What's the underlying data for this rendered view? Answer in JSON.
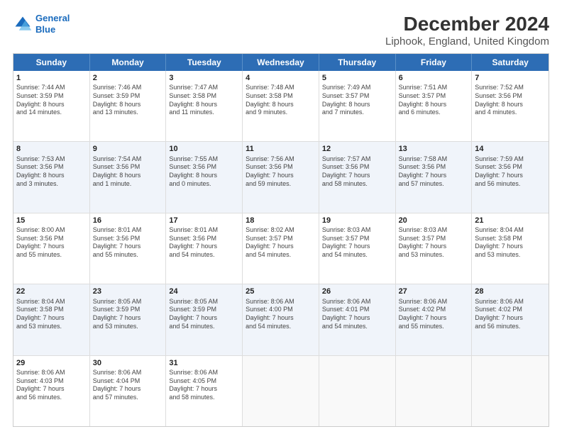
{
  "header": {
    "logo_line1": "General",
    "logo_line2": "Blue",
    "title": "December 2024",
    "subtitle": "Liphook, England, United Kingdom"
  },
  "days_of_week": [
    "Sunday",
    "Monday",
    "Tuesday",
    "Wednesday",
    "Thursday",
    "Friday",
    "Saturday"
  ],
  "rows": [
    [
      {
        "day": "1",
        "lines": [
          "Sunrise: 7:44 AM",
          "Sunset: 3:59 PM",
          "Daylight: 8 hours",
          "and 14 minutes."
        ]
      },
      {
        "day": "2",
        "lines": [
          "Sunrise: 7:46 AM",
          "Sunset: 3:59 PM",
          "Daylight: 8 hours",
          "and 13 minutes."
        ]
      },
      {
        "day": "3",
        "lines": [
          "Sunrise: 7:47 AM",
          "Sunset: 3:58 PM",
          "Daylight: 8 hours",
          "and 11 minutes."
        ]
      },
      {
        "day": "4",
        "lines": [
          "Sunrise: 7:48 AM",
          "Sunset: 3:58 PM",
          "Daylight: 8 hours",
          "and 9 minutes."
        ]
      },
      {
        "day": "5",
        "lines": [
          "Sunrise: 7:49 AM",
          "Sunset: 3:57 PM",
          "Daylight: 8 hours",
          "and 7 minutes."
        ]
      },
      {
        "day": "6",
        "lines": [
          "Sunrise: 7:51 AM",
          "Sunset: 3:57 PM",
          "Daylight: 8 hours",
          "and 6 minutes."
        ]
      },
      {
        "day": "7",
        "lines": [
          "Sunrise: 7:52 AM",
          "Sunset: 3:56 PM",
          "Daylight: 8 hours",
          "and 4 minutes."
        ]
      }
    ],
    [
      {
        "day": "8",
        "lines": [
          "Sunrise: 7:53 AM",
          "Sunset: 3:56 PM",
          "Daylight: 8 hours",
          "and 3 minutes."
        ]
      },
      {
        "day": "9",
        "lines": [
          "Sunrise: 7:54 AM",
          "Sunset: 3:56 PM",
          "Daylight: 8 hours",
          "and 1 minute."
        ]
      },
      {
        "day": "10",
        "lines": [
          "Sunrise: 7:55 AM",
          "Sunset: 3:56 PM",
          "Daylight: 8 hours",
          "and 0 minutes."
        ]
      },
      {
        "day": "11",
        "lines": [
          "Sunrise: 7:56 AM",
          "Sunset: 3:56 PM",
          "Daylight: 7 hours",
          "and 59 minutes."
        ]
      },
      {
        "day": "12",
        "lines": [
          "Sunrise: 7:57 AM",
          "Sunset: 3:56 PM",
          "Daylight: 7 hours",
          "and 58 minutes."
        ]
      },
      {
        "day": "13",
        "lines": [
          "Sunrise: 7:58 AM",
          "Sunset: 3:56 PM",
          "Daylight: 7 hours",
          "and 57 minutes."
        ]
      },
      {
        "day": "14",
        "lines": [
          "Sunrise: 7:59 AM",
          "Sunset: 3:56 PM",
          "Daylight: 7 hours",
          "and 56 minutes."
        ]
      }
    ],
    [
      {
        "day": "15",
        "lines": [
          "Sunrise: 8:00 AM",
          "Sunset: 3:56 PM",
          "Daylight: 7 hours",
          "and 55 minutes."
        ]
      },
      {
        "day": "16",
        "lines": [
          "Sunrise: 8:01 AM",
          "Sunset: 3:56 PM",
          "Daylight: 7 hours",
          "and 55 minutes."
        ]
      },
      {
        "day": "17",
        "lines": [
          "Sunrise: 8:01 AM",
          "Sunset: 3:56 PM",
          "Daylight: 7 hours",
          "and 54 minutes."
        ]
      },
      {
        "day": "18",
        "lines": [
          "Sunrise: 8:02 AM",
          "Sunset: 3:57 PM",
          "Daylight: 7 hours",
          "and 54 minutes."
        ]
      },
      {
        "day": "19",
        "lines": [
          "Sunrise: 8:03 AM",
          "Sunset: 3:57 PM",
          "Daylight: 7 hours",
          "and 54 minutes."
        ]
      },
      {
        "day": "20",
        "lines": [
          "Sunrise: 8:03 AM",
          "Sunset: 3:57 PM",
          "Daylight: 7 hours",
          "and 53 minutes."
        ]
      },
      {
        "day": "21",
        "lines": [
          "Sunrise: 8:04 AM",
          "Sunset: 3:58 PM",
          "Daylight: 7 hours",
          "and 53 minutes."
        ]
      }
    ],
    [
      {
        "day": "22",
        "lines": [
          "Sunrise: 8:04 AM",
          "Sunset: 3:58 PM",
          "Daylight: 7 hours",
          "and 53 minutes."
        ]
      },
      {
        "day": "23",
        "lines": [
          "Sunrise: 8:05 AM",
          "Sunset: 3:59 PM",
          "Daylight: 7 hours",
          "and 53 minutes."
        ]
      },
      {
        "day": "24",
        "lines": [
          "Sunrise: 8:05 AM",
          "Sunset: 3:59 PM",
          "Daylight: 7 hours",
          "and 54 minutes."
        ]
      },
      {
        "day": "25",
        "lines": [
          "Sunrise: 8:06 AM",
          "Sunset: 4:00 PM",
          "Daylight: 7 hours",
          "and 54 minutes."
        ]
      },
      {
        "day": "26",
        "lines": [
          "Sunrise: 8:06 AM",
          "Sunset: 4:01 PM",
          "Daylight: 7 hours",
          "and 54 minutes."
        ]
      },
      {
        "day": "27",
        "lines": [
          "Sunrise: 8:06 AM",
          "Sunset: 4:02 PM",
          "Daylight: 7 hours",
          "and 55 minutes."
        ]
      },
      {
        "day": "28",
        "lines": [
          "Sunrise: 8:06 AM",
          "Sunset: 4:02 PM",
          "Daylight: 7 hours",
          "and 56 minutes."
        ]
      }
    ],
    [
      {
        "day": "29",
        "lines": [
          "Sunrise: 8:06 AM",
          "Sunset: 4:03 PM",
          "Daylight: 7 hours",
          "and 56 minutes."
        ]
      },
      {
        "day": "30",
        "lines": [
          "Sunrise: 8:06 AM",
          "Sunset: 4:04 PM",
          "Daylight: 7 hours",
          "and 57 minutes."
        ]
      },
      {
        "day": "31",
        "lines": [
          "Sunrise: 8:06 AM",
          "Sunset: 4:05 PM",
          "Daylight: 7 hours",
          "and 58 minutes."
        ]
      },
      {
        "day": "",
        "lines": []
      },
      {
        "day": "",
        "lines": []
      },
      {
        "day": "",
        "lines": []
      },
      {
        "day": "",
        "lines": []
      }
    ]
  ]
}
